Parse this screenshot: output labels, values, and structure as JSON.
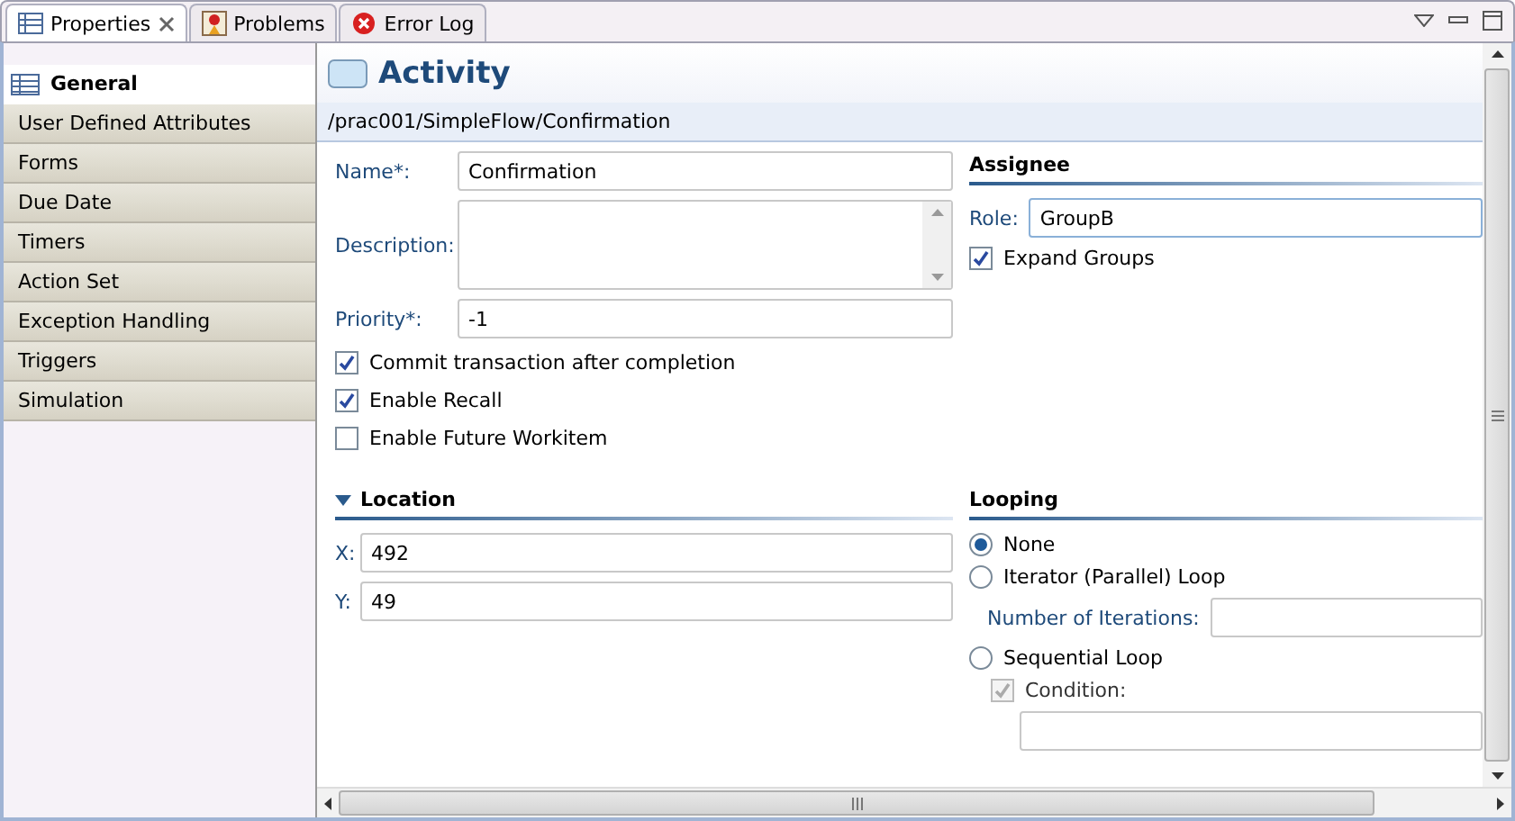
{
  "tabs": [
    {
      "label": "Properties",
      "selected": true,
      "closable": true
    },
    {
      "label": "Problems",
      "selected": false,
      "closable": false
    },
    {
      "label": "Error Log",
      "selected": false,
      "closable": false
    }
  ],
  "sidebar": {
    "items": [
      {
        "label": "General",
        "selected": true
      },
      {
        "label": "User Defined Attributes",
        "selected": false
      },
      {
        "label": "Forms",
        "selected": false
      },
      {
        "label": "Due Date",
        "selected": false
      },
      {
        "label": "Timers",
        "selected": false
      },
      {
        "label": "Action Set",
        "selected": false
      },
      {
        "label": "Exception Handling",
        "selected": false
      },
      {
        "label": "Triggers",
        "selected": false
      },
      {
        "label": "Simulation",
        "selected": false
      }
    ]
  },
  "header": {
    "title": "Activity",
    "path": "/prac001/SimpleFlow/Confirmation"
  },
  "general": {
    "name": {
      "label": "Name*:",
      "value": "Confirmation"
    },
    "description": {
      "label": "Description:"
    },
    "priority": {
      "label": "Priority*:",
      "value": "-1"
    },
    "checkboxes": [
      {
        "label": "Commit transaction after completion",
        "checked": true
      },
      {
        "label": "Enable Recall",
        "checked": true
      },
      {
        "label": "Enable Future Workitem",
        "checked": false
      }
    ]
  },
  "assignee": {
    "title": "Assignee",
    "role": {
      "label": "Role:",
      "value": "GroupB"
    },
    "expand_groups": {
      "label": "Expand Groups",
      "checked": true
    }
  },
  "location": {
    "title": "Location",
    "expanded": true,
    "x": {
      "label": "X:",
      "value": "492"
    },
    "y": {
      "label": "Y:",
      "value": "49"
    }
  },
  "looping": {
    "title": "Looping",
    "options": [
      {
        "label": "None",
        "selected": true
      },
      {
        "label": "Iterator (Parallel) Loop",
        "selected": false,
        "detail": {
          "kind": "field",
          "label": "Number of Iterations:"
        }
      },
      {
        "label": "Sequential Loop",
        "selected": false,
        "detail": {
          "kind": "checkbox",
          "label": "Condition:",
          "checked": true,
          "disabled": true
        }
      }
    ]
  }
}
